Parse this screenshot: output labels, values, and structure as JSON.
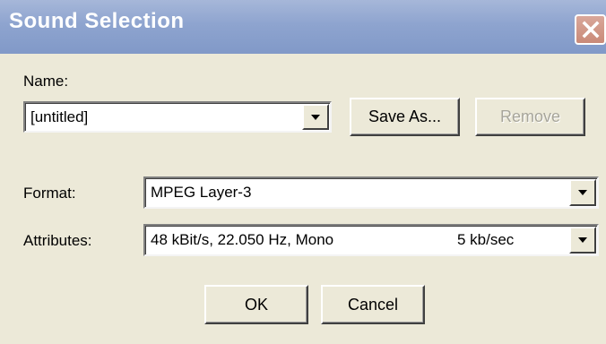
{
  "window": {
    "title": "Sound Selection",
    "close_icon": "close-icon",
    "colors": {
      "titlebar": "#8ea4cf",
      "close_button": "#c98a78",
      "dialog_background": "#ece9d8"
    }
  },
  "name_field": {
    "label": "Name:",
    "value": "[untitled]"
  },
  "buttons": {
    "save_as": "Save As...",
    "remove": "Remove",
    "ok": "OK",
    "cancel": "Cancel"
  },
  "format_field": {
    "label": "Format:",
    "value": "MPEG Layer-3"
  },
  "attributes_field": {
    "label": "Attributes:",
    "value": "48 kBit/s, 22.050 Hz, Mono",
    "rate": "5 kb/sec"
  }
}
